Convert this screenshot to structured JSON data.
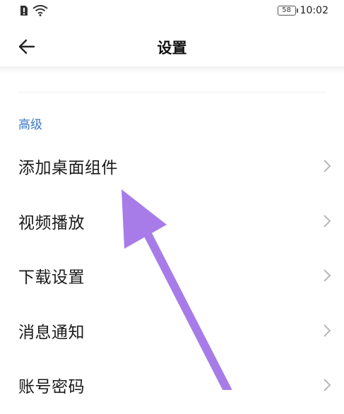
{
  "status_bar": {
    "battery_level": "58",
    "time": "10:02"
  },
  "header": {
    "title": "设置"
  },
  "section": {
    "title": "高级"
  },
  "items": [
    {
      "label": "添加桌面组件"
    },
    {
      "label": "视频播放"
    },
    {
      "label": "下载设置"
    },
    {
      "label": "消息通知"
    },
    {
      "label": "账号密码"
    }
  ],
  "colors": {
    "accent": "#3a78c4",
    "annotation_arrow": "#a77ce8"
  },
  "icons": {
    "back": "arrow-left-icon",
    "row": "chevron-right-icon",
    "status": [
      "sim-alert-icon",
      "wifi-icon",
      "battery-icon"
    ]
  }
}
